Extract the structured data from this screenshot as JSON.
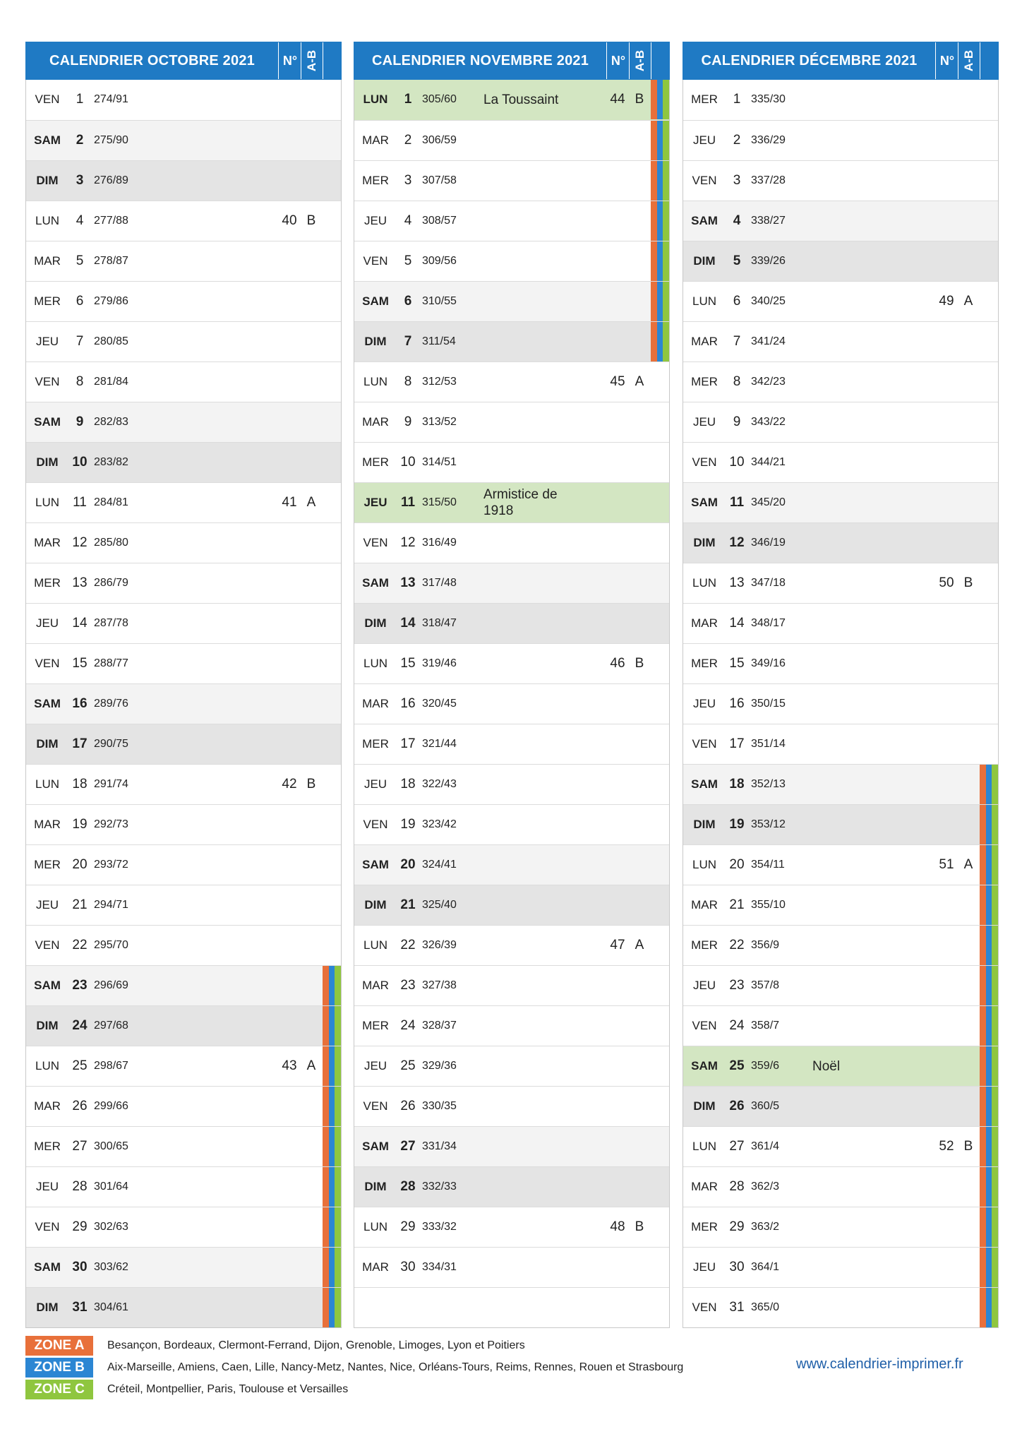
{
  "header_labels": {
    "week": "N°",
    "ab": "A-B"
  },
  "zone_colors": {
    "A": "#e8703a",
    "B": "#2b86d3",
    "C": "#8fc63f"
  },
  "months": [
    {
      "title": "CALENDRIER OCTOBRE 2021",
      "days": [
        {
          "dn": "VEN",
          "d": "1",
          "dy": "274/91"
        },
        {
          "dn": "SAM",
          "d": "2",
          "dy": "275/90"
        },
        {
          "dn": "DIM",
          "d": "3",
          "dy": "276/89"
        },
        {
          "dn": "LUN",
          "d": "4",
          "dy": "277/88",
          "wk": "40",
          "ab": "B"
        },
        {
          "dn": "MAR",
          "d": "5",
          "dy": "278/87"
        },
        {
          "dn": "MER",
          "d": "6",
          "dy": "279/86"
        },
        {
          "dn": "JEU",
          "d": "7",
          "dy": "280/85"
        },
        {
          "dn": "VEN",
          "d": "8",
          "dy": "281/84"
        },
        {
          "dn": "SAM",
          "d": "9",
          "dy": "282/83"
        },
        {
          "dn": "DIM",
          "d": "10",
          "dy": "283/82"
        },
        {
          "dn": "LUN",
          "d": "11",
          "dy": "284/81",
          "wk": "41",
          "ab": "A"
        },
        {
          "dn": "MAR",
          "d": "12",
          "dy": "285/80"
        },
        {
          "dn": "MER",
          "d": "13",
          "dy": "286/79"
        },
        {
          "dn": "JEU",
          "d": "14",
          "dy": "287/78"
        },
        {
          "dn": "VEN",
          "d": "15",
          "dy": "288/77"
        },
        {
          "dn": "SAM",
          "d": "16",
          "dy": "289/76"
        },
        {
          "dn": "DIM",
          "d": "17",
          "dy": "290/75"
        },
        {
          "dn": "LUN",
          "d": "18",
          "dy": "291/74",
          "wk": "42",
          "ab": "B"
        },
        {
          "dn": "MAR",
          "d": "19",
          "dy": "292/73"
        },
        {
          "dn": "MER",
          "d": "20",
          "dy": "293/72"
        },
        {
          "dn": "JEU",
          "d": "21",
          "dy": "294/71"
        },
        {
          "dn": "VEN",
          "d": "22",
          "dy": "295/70"
        },
        {
          "dn": "SAM",
          "d": "23",
          "dy": "296/69",
          "zones": [
            "A",
            "B",
            "C"
          ]
        },
        {
          "dn": "DIM",
          "d": "24",
          "dy": "297/68",
          "zones": [
            "A",
            "B",
            "C"
          ]
        },
        {
          "dn": "LUN",
          "d": "25",
          "dy": "298/67",
          "wk": "43",
          "ab": "A",
          "zones": [
            "A",
            "B",
            "C"
          ]
        },
        {
          "dn": "MAR",
          "d": "26",
          "dy": "299/66",
          "zones": [
            "A",
            "B",
            "C"
          ]
        },
        {
          "dn": "MER",
          "d": "27",
          "dy": "300/65",
          "zones": [
            "A",
            "B",
            "C"
          ]
        },
        {
          "dn": "JEU",
          "d": "28",
          "dy": "301/64",
          "zones": [
            "A",
            "B",
            "C"
          ]
        },
        {
          "dn": "VEN",
          "d": "29",
          "dy": "302/63",
          "zones": [
            "A",
            "B",
            "C"
          ]
        },
        {
          "dn": "SAM",
          "d": "30",
          "dy": "303/62",
          "zones": [
            "A",
            "B",
            "C"
          ]
        },
        {
          "dn": "DIM",
          "d": "31",
          "dy": "304/61",
          "zones": [
            "A",
            "B",
            "C"
          ]
        }
      ]
    },
    {
      "title": "CALENDRIER NOVEMBRE 2021",
      "days": [
        {
          "dn": "LUN",
          "d": "1",
          "dy": "305/60",
          "hol": "La Toussaint",
          "wk": "44",
          "ab": "B",
          "ferie": true,
          "zones": [
            "A",
            "B",
            "C"
          ]
        },
        {
          "dn": "MAR",
          "d": "2",
          "dy": "306/59",
          "zones": [
            "A",
            "B",
            "C"
          ]
        },
        {
          "dn": "MER",
          "d": "3",
          "dy": "307/58",
          "zones": [
            "A",
            "B",
            "C"
          ]
        },
        {
          "dn": "JEU",
          "d": "4",
          "dy": "308/57",
          "zones": [
            "A",
            "B",
            "C"
          ]
        },
        {
          "dn": "VEN",
          "d": "5",
          "dy": "309/56",
          "zones": [
            "A",
            "B",
            "C"
          ]
        },
        {
          "dn": "SAM",
          "d": "6",
          "dy": "310/55",
          "zones": [
            "A",
            "B",
            "C"
          ]
        },
        {
          "dn": "DIM",
          "d": "7",
          "dy": "311/54",
          "zones": [
            "A",
            "B",
            "C"
          ]
        },
        {
          "dn": "LUN",
          "d": "8",
          "dy": "312/53",
          "wk": "45",
          "ab": "A"
        },
        {
          "dn": "MAR",
          "d": "9",
          "dy": "313/52"
        },
        {
          "dn": "MER",
          "d": "10",
          "dy": "314/51"
        },
        {
          "dn": "JEU",
          "d": "11",
          "dy": "315/50",
          "hol": "Armistice de 1918",
          "ferie": true
        },
        {
          "dn": "VEN",
          "d": "12",
          "dy": "316/49"
        },
        {
          "dn": "SAM",
          "d": "13",
          "dy": "317/48"
        },
        {
          "dn": "DIM",
          "d": "14",
          "dy": "318/47"
        },
        {
          "dn": "LUN",
          "d": "15",
          "dy": "319/46",
          "wk": "46",
          "ab": "B"
        },
        {
          "dn": "MAR",
          "d": "16",
          "dy": "320/45"
        },
        {
          "dn": "MER",
          "d": "17",
          "dy": "321/44"
        },
        {
          "dn": "JEU",
          "d": "18",
          "dy": "322/43"
        },
        {
          "dn": "VEN",
          "d": "19",
          "dy": "323/42"
        },
        {
          "dn": "SAM",
          "d": "20",
          "dy": "324/41"
        },
        {
          "dn": "DIM",
          "d": "21",
          "dy": "325/40"
        },
        {
          "dn": "LUN",
          "d": "22",
          "dy": "326/39",
          "wk": "47",
          "ab": "A"
        },
        {
          "dn": "MAR",
          "d": "23",
          "dy": "327/38"
        },
        {
          "dn": "MER",
          "d": "24",
          "dy": "328/37"
        },
        {
          "dn": "JEU",
          "d": "25",
          "dy": "329/36"
        },
        {
          "dn": "VEN",
          "d": "26",
          "dy": "330/35"
        },
        {
          "dn": "SAM",
          "d": "27",
          "dy": "331/34"
        },
        {
          "dn": "DIM",
          "d": "28",
          "dy": "332/33"
        },
        {
          "dn": "LUN",
          "d": "29",
          "dy": "333/32",
          "wk": "48",
          "ab": "B"
        },
        {
          "dn": "MAR",
          "d": "30",
          "dy": "334/31"
        }
      ]
    },
    {
      "title": "CALENDRIER DÉCEMBRE 2021",
      "days": [
        {
          "dn": "MER",
          "d": "1",
          "dy": "335/30"
        },
        {
          "dn": "JEU",
          "d": "2",
          "dy": "336/29"
        },
        {
          "dn": "VEN",
          "d": "3",
          "dy": "337/28"
        },
        {
          "dn": "SAM",
          "d": "4",
          "dy": "338/27"
        },
        {
          "dn": "DIM",
          "d": "5",
          "dy": "339/26"
        },
        {
          "dn": "LUN",
          "d": "6",
          "dy": "340/25",
          "wk": "49",
          "ab": "A"
        },
        {
          "dn": "MAR",
          "d": "7",
          "dy": "341/24"
        },
        {
          "dn": "MER",
          "d": "8",
          "dy": "342/23"
        },
        {
          "dn": "JEU",
          "d": "9",
          "dy": "343/22"
        },
        {
          "dn": "VEN",
          "d": "10",
          "dy": "344/21"
        },
        {
          "dn": "SAM",
          "d": "11",
          "dy": "345/20"
        },
        {
          "dn": "DIM",
          "d": "12",
          "dy": "346/19"
        },
        {
          "dn": "LUN",
          "d": "13",
          "dy": "347/18",
          "wk": "50",
          "ab": "B"
        },
        {
          "dn": "MAR",
          "d": "14",
          "dy": "348/17"
        },
        {
          "dn": "MER",
          "d": "15",
          "dy": "349/16"
        },
        {
          "dn": "JEU",
          "d": "16",
          "dy": "350/15"
        },
        {
          "dn": "VEN",
          "d": "17",
          "dy": "351/14"
        },
        {
          "dn": "SAM",
          "d": "18",
          "dy": "352/13",
          "zones": [
            "A",
            "B",
            "C"
          ]
        },
        {
          "dn": "DIM",
          "d": "19",
          "dy": "353/12",
          "zones": [
            "A",
            "B",
            "C"
          ]
        },
        {
          "dn": "LUN",
          "d": "20",
          "dy": "354/11",
          "wk": "51",
          "ab": "A",
          "zones": [
            "A",
            "B",
            "C"
          ]
        },
        {
          "dn": "MAR",
          "d": "21",
          "dy": "355/10",
          "zones": [
            "A",
            "B",
            "C"
          ]
        },
        {
          "dn": "MER",
          "d": "22",
          "dy": "356/9",
          "zones": [
            "A",
            "B",
            "C"
          ]
        },
        {
          "dn": "JEU",
          "d": "23",
          "dy": "357/8",
          "zones": [
            "A",
            "B",
            "C"
          ]
        },
        {
          "dn": "VEN",
          "d": "24",
          "dy": "358/7",
          "zones": [
            "A",
            "B",
            "C"
          ]
        },
        {
          "dn": "SAM",
          "d": "25",
          "dy": "359/6",
          "hol": "Noël",
          "ferie": true,
          "zones": [
            "A",
            "B",
            "C"
          ]
        },
        {
          "dn": "DIM",
          "d": "26",
          "dy": "360/5",
          "zones": [
            "A",
            "B",
            "C"
          ]
        },
        {
          "dn": "LUN",
          "d": "27",
          "dy": "361/4",
          "wk": "52",
          "ab": "B",
          "zones": [
            "A",
            "B",
            "C"
          ]
        },
        {
          "dn": "MAR",
          "d": "28",
          "dy": "362/3",
          "zones": [
            "A",
            "B",
            "C"
          ]
        },
        {
          "dn": "MER",
          "d": "29",
          "dy": "363/2",
          "zones": [
            "A",
            "B",
            "C"
          ]
        },
        {
          "dn": "JEU",
          "d": "30",
          "dy": "364/1",
          "zones": [
            "A",
            "B",
            "C"
          ]
        },
        {
          "dn": "VEN",
          "d": "31",
          "dy": "365/0",
          "zones": [
            "A",
            "B",
            "C"
          ]
        }
      ]
    }
  ],
  "legend": [
    {
      "label": "ZONE A",
      "zone": "A",
      "text": "Besançon, Bordeaux, Clermont-Ferrand, Dijon, Grenoble, Limoges, Lyon et Poitiers"
    },
    {
      "label": "ZONE B",
      "zone": "B",
      "text": "Aix-Marseille, Amiens, Caen, Lille, Nancy-Metz, Nantes, Nice, Orléans-Tours, Reims, Rennes, Rouen et Strasbourg"
    },
    {
      "label": "ZONE C",
      "zone": "C",
      "text": "Créteil, Montpellier, Paris, Toulouse et Versailles"
    }
  ],
  "website": "www.calendrier-imprimer.fr"
}
